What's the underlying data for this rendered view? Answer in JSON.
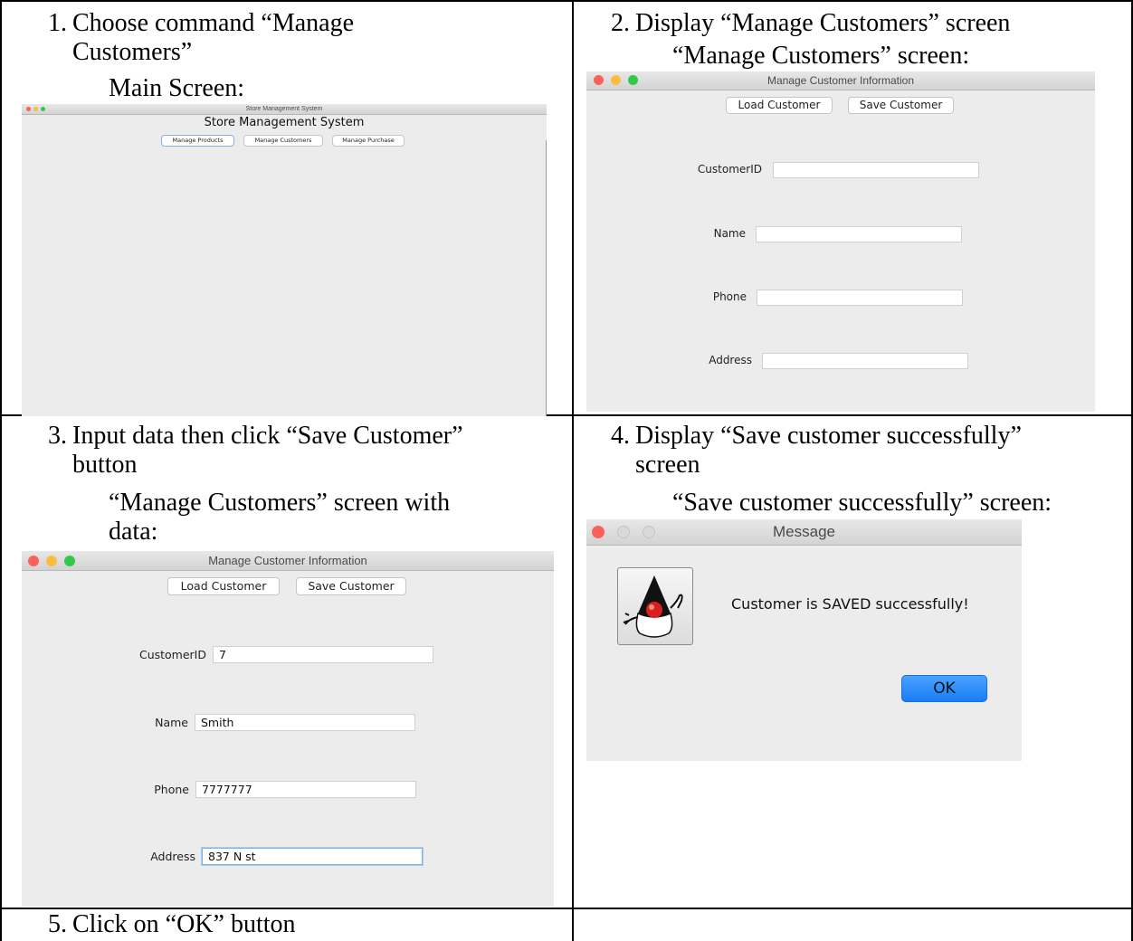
{
  "steps": [
    {
      "num": "1.",
      "lines": [
        "Choose command “Manage",
        "Customers”"
      ],
      "caption": "Main Screen:"
    },
    {
      "num": "2.",
      "lines": [
        "Display “Manage Customers” screen"
      ],
      "caption": "“Manage Customers” screen:"
    },
    {
      "num": "3.",
      "lines": [
        "Input data then click “Save Customer”",
        "button"
      ],
      "caption_lines": [
        "“Manage Customers” screen with",
        "data:"
      ]
    },
    {
      "num": "4.",
      "lines": [
        "Display “Save customer successfully”",
        "screen"
      ],
      "caption": "“Save customer successfully” screen:"
    },
    {
      "num": "5.",
      "lines": [
        "Click on “OK” button"
      ]
    }
  ],
  "main_screen": {
    "window_title": "Store Management System",
    "heading": "Store Management System",
    "buttons": [
      "Manage Products",
      "Manage Customers",
      "Manage Purchase"
    ]
  },
  "manage_customers": {
    "window_title": "Manage Customer Information",
    "buttons": [
      "Load Customer",
      "Save Customer"
    ],
    "fields": [
      {
        "label": "CustomerID",
        "value": ""
      },
      {
        "label": "Name",
        "value": ""
      },
      {
        "label": "Phone",
        "value": ""
      },
      {
        "label": "Address",
        "value": ""
      }
    ]
  },
  "manage_customers_filled": {
    "window_title": "Manage Customer Information",
    "buttons": [
      "Load Customer",
      "Save Customer"
    ],
    "fields": [
      {
        "label": "CustomerID",
        "value": "7"
      },
      {
        "label": "Name",
        "value": "Smith"
      },
      {
        "label": "Phone",
        "value": "7777777"
      },
      {
        "label": "Address",
        "value": "837 N st"
      }
    ]
  },
  "message_dialog": {
    "window_title": "Message",
    "icon": "java-duke-icon",
    "text": "Customer is SAVED successfully!",
    "ok_label": "OK"
  },
  "colors": {
    "traffic_red": "#fc605b",
    "traffic_yellow": "#fdbc40",
    "traffic_green": "#34c84a",
    "ok_button": "#1a82fb"
  }
}
